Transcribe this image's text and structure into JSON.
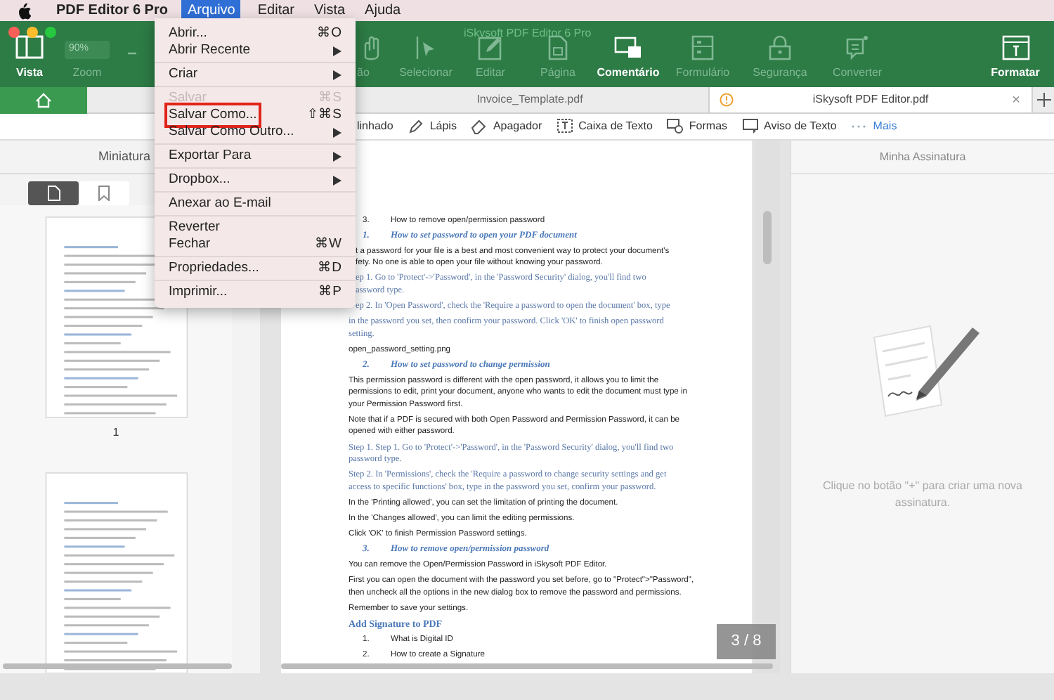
{
  "menu_bar": {
    "app": "PDF Editor 6 Pro",
    "menus": [
      {
        "label": "Arquivo",
        "selected": true
      },
      {
        "label": "Editar",
        "selected": false
      },
      {
        "label": "Vista",
        "selected": false
      },
      {
        "label": "Ajuda",
        "selected": false
      }
    ]
  },
  "window": {
    "title": "iSkysoft PDF Editor 6 Pro"
  },
  "toolbar": {
    "view": {
      "label": "Vista",
      "enabled": true
    },
    "zoom": {
      "value": "90%",
      "label": "Zoom"
    },
    "tools": [
      {
        "label": "ão",
        "enabled": false
      },
      {
        "label": "Selecionar",
        "enabled": false
      },
      {
        "label": "Editar",
        "enabled": false
      },
      {
        "label": "Página",
        "enabled": false
      },
      {
        "label": "Comentário",
        "enabled": true
      },
      {
        "label": "Formulário",
        "enabled": false
      },
      {
        "label": "Segurança",
        "enabled": false
      },
      {
        "label": "Converter",
        "enabled": false
      }
    ],
    "format": {
      "label": "Formatar",
      "enabled": true
    }
  },
  "tabs": [
    {
      "label": "Invoice_Template.pdf",
      "selected": false,
      "warning": false
    },
    {
      "label": "iSkysoft PDF Editor.pdf",
      "selected": true,
      "warning": true,
      "close": "×"
    }
  ],
  "comment_tools": [
    {
      "label": "linhado"
    },
    {
      "label": "Lápis"
    },
    {
      "label": "Apagador"
    },
    {
      "label": "Caixa de Texto"
    },
    {
      "label": "Formas"
    },
    {
      "label": "Aviso de Texto"
    },
    {
      "label": "Mais"
    }
  ],
  "sidebar": {
    "title": "Miniatura",
    "tabs": [
      {
        "selected": true
      },
      {
        "selected": false
      }
    ],
    "thumbnails": [
      {
        "kind": "page",
        "label": "1"
      },
      {
        "kind": "page"
      }
    ]
  },
  "file_menu": [
    [
      {
        "label": "Abrir...",
        "shortcut": "⌘O",
        "submenu": false,
        "disabled": false,
        "highlighted": false
      },
      {
        "label": "Abrir Recente",
        "submenu": true,
        "disabled": false,
        "highlighted": false
      }
    ],
    [
      {
        "label": "Criar",
        "submenu": true,
        "disabled": false,
        "highlighted": false
      }
    ],
    [
      {
        "label": "Salvar",
        "shortcut": "⌘S",
        "submenu": false,
        "disabled": true,
        "highlighted": false
      },
      {
        "label": "Salvar Como...",
        "shortcut": "⇧⌘S",
        "submenu": false,
        "disabled": false,
        "highlighted": true
      },
      {
        "label": "Salvar Como Outro...",
        "submenu": true,
        "disabled": false,
        "highlighted": false
      }
    ],
    [
      {
        "label": "Exportar Para",
        "submenu": true,
        "disabled": false,
        "highlighted": false
      }
    ],
    [
      {
        "label": "Dropbox...",
        "submenu": true,
        "disabled": false,
        "highlighted": false
      }
    ],
    [
      {
        "label": "Anexar ao E-mail",
        "submenu": false,
        "disabled": false,
        "highlighted": false
      }
    ],
    [
      {
        "label": "Reverter",
        "submenu": false,
        "disabled": false,
        "highlighted": false
      },
      {
        "label": "Fechar",
        "shortcut": "⌘W",
        "submenu": false,
        "disabled": false,
        "highlighted": false
      }
    ],
    [
      {
        "label": "Propriedades...",
        "shortcut": "⌘D",
        "submenu": false,
        "disabled": false,
        "highlighted": false
      }
    ],
    [
      {
        "label": "Imprimir...",
        "shortcut": "⌘P",
        "submenu": false,
        "disabled": false,
        "highlighted": false
      }
    ]
  ],
  "document": {
    "blocks": [
      {
        "kind": "item",
        "number": "3.",
        "clipped": false,
        "lines": [
          "How to remove open/permission password"
        ]
      },
      {
        "kind": "heading",
        "number": "1.",
        "clipped": false,
        "lines": [
          "How to set password to open your PDF document"
        ]
      },
      {
        "kind": "text",
        "clipped": true,
        "lines": [
          "t a password for your file is a best and most convenient way to protect your document's",
          "fety. No one is able to open your file without knowing your password."
        ]
      },
      {
        "kind": "step",
        "clipped": true,
        "lines": [
          "ep 1. Go to 'Protect'->'Password', in the 'Password Security' dialog, you'll find two",
          "assword type."
        ]
      },
      {
        "kind": "step",
        "clipped": true,
        "lines": [
          "ep 2. In 'Open Password', check the 'Require a password to open the document' box, type"
        ]
      },
      {
        "kind": "step",
        "clipped": false,
        "lines": [
          "in the password you set, then confirm your password. Click 'OK' to finish open password",
          "setting."
        ]
      },
      {
        "kind": "text",
        "clipped": false,
        "lines": [
          "open_password_setting.png"
        ]
      },
      {
        "kind": "heading",
        "number": "2.",
        "clipped": false,
        "lines": [
          "How to set password to change permission"
        ]
      },
      {
        "kind": "text",
        "clipped": false,
        "lines": [
          "This permission password is different with the open password, it allows you to limit the",
          "permissions to edit, print your document, anyone who wants to edit the document must type in",
          "your Permission Password first."
        ]
      },
      {
        "kind": "text",
        "clipped": false,
        "lines": [
          "Note that if a PDF is secured with both Open Password and Permission Password, it can be",
          "opened with either password."
        ]
      },
      {
        "kind": "step",
        "clipped": false,
        "lines": [
          "Step 1. Step 1. Go to 'Protect'->'Password', in the 'Password Security' dialog, you'll find two",
          "password type."
        ]
      },
      {
        "kind": "step",
        "clipped": false,
        "lines": [
          "Step 2. In 'Permissions', check the 'Require a password to change security settings and get",
          "access to specific functions' box, type in the password you set, confirm your password."
        ]
      },
      {
        "kind": "text",
        "clipped": false,
        "lines": [
          "In the 'Printing allowed', you can set the limitation of printing the document."
        ]
      },
      {
        "kind": "text",
        "clipped": false,
        "lines": [
          "In the 'Changes allowed', you can limit the editing permissions."
        ]
      },
      {
        "kind": "text",
        "clipped": false,
        "lines": [
          "Click 'OK' to finish Permission Password settings."
        ]
      },
      {
        "kind": "heading",
        "number": "3.",
        "clipped": false,
        "lines": [
          "How to remove open/permission password"
        ]
      },
      {
        "kind": "text",
        "clipped": false,
        "lines": [
          "You can remove the Open/Permission Password in iSkysoft PDF Editor."
        ]
      },
      {
        "kind": "text",
        "clipped": false,
        "lines": [
          "First you can open the document with the password you set before, go to \"Protect\">\"Password\",",
          "then uncheck all the options in the new dialog box to remove the password and permissions."
        ]
      },
      {
        "kind": "text",
        "clipped": false,
        "lines": [
          "Remember to save your settings."
        ]
      },
      {
        "kind": "title",
        "clipped": false,
        "lines": [
          "Add Signature to PDF"
        ]
      },
      {
        "kind": "item",
        "number": "1.",
        "clipped": false,
        "lines": [
          "What is Digital ID"
        ]
      },
      {
        "kind": "item",
        "number": "2.",
        "clipped": false,
        "lines": [
          "How to create a Signature"
        ]
      }
    ],
    "page_indicator": "3 / 8"
  },
  "signature_panel": {
    "title": "Minha Assinatura",
    "hint": "Clique no botão \"+\" para criar uma nova assinatura."
  }
}
